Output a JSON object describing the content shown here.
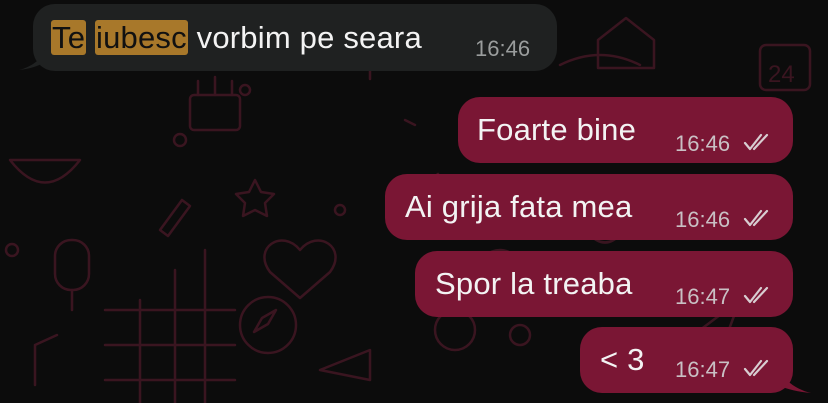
{
  "chat": {
    "wallpaper": {
      "background": "#0c0c0c",
      "doodle_color": "#3a1520"
    },
    "colors": {
      "incoming": "#1f2121",
      "outgoing": "#7a1634",
      "highlight": "#a8782a"
    },
    "messages": [
      {
        "direction": "incoming",
        "highlight_1": "Te",
        "highlight_2": "iubesc",
        "text_rest": "vorbim pe seara",
        "time": "16:46"
      },
      {
        "direction": "outgoing",
        "text": "Foarte bine",
        "time": "16:46",
        "status": "read-double-check-icon"
      },
      {
        "direction": "outgoing",
        "text": "Ai grija fata mea",
        "time": "16:46",
        "status": "read-double-check-icon"
      },
      {
        "direction": "outgoing",
        "text": "Spor la treaba",
        "time": "16:47",
        "status": "read-double-check-icon"
      },
      {
        "direction": "outgoing",
        "text": "< 3",
        "time": "16:47",
        "status": "read-double-check-icon"
      }
    ]
  }
}
